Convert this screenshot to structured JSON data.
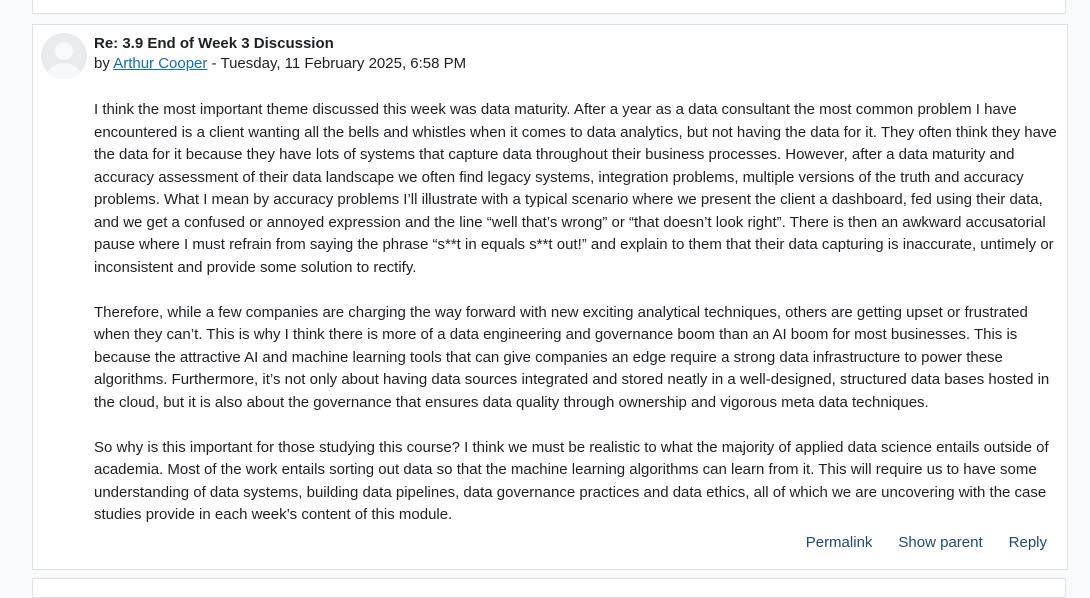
{
  "post": {
    "subject": "Re: 3.9 End of Week 3 Discussion",
    "by_prefix": "by",
    "author": "Arthur Cooper",
    "date_separator": " - ",
    "date": "Tuesday, 11 February 2025, 6:58 PM",
    "paragraphs": [
      "I think the most important theme discussed this week was data maturity. After a year as a data consultant the most common problem I have encountered is a client wanting all the bells and whistles when it comes to data analytics, but not having the data for it. They often think they have the data for it because they have lots of systems that capture data throughout their business processes. However, after a data maturity and accuracy assessment of their data landscape we often find legacy systems, integration problems, multiple versions of the truth and accuracy problems. What I mean by accuracy problems I’ll illustrate with a typical scenario where we present the client a dashboard, fed using their data, and we get a confused or annoyed expression and the line “well that’s wrong” or “that doesn’t look right”. There is then an awkward accusatorial pause where I must refrain from saying the phrase “s**t in equals s**t out!” and explain to them that their data capturing is inaccurate, untimely or inconsistent and provide some solution to rectify.",
      "Therefore, while a few companies are charging the way forward with new exciting analytical techniques, others are getting upset or frustrated when they can’t. This is why I think there is more of a data engineering and governance boom than an AI boom for most businesses. This is because the attractive AI and machine learning tools that can give companies an edge require a strong data infrastructure to power these algorithms. Furthermore, it’s not only about having data sources integrated and stored neatly in a well-designed, structured data bases hosted in the cloud, but it is also about the governance that ensures data quality through ownership and vigorous meta data techniques.",
      "So why is this important for those studying this course? I think we must be realistic to what the majority of applied data science entails outside of academia. Most of the work entails sorting out data so that the machine learning algorithms can learn from it. This will require us to have some understanding of data systems, building data pipelines, data governance practices and data ethics, all of which we are uncovering with the case studies provide in each week’s content of this module."
    ],
    "actions": {
      "permalink": "Permalink",
      "show_parent": "Show parent",
      "reply": "Reply"
    }
  },
  "colors": {
    "link": "#0f6cbf",
    "action_link": "#1d4a78",
    "border": "#dee2e6",
    "avatar_bg": "#e9ecef"
  },
  "icons": {
    "avatar": "default-user-avatar-icon"
  }
}
